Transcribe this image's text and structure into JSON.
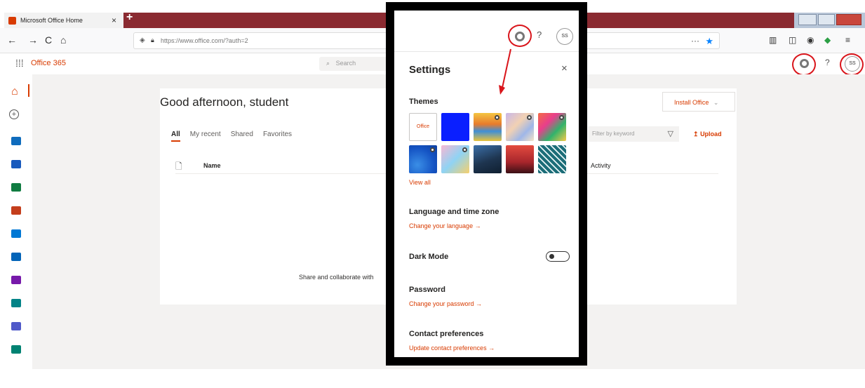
{
  "browser": {
    "tab_title": "Microsoft Office Home",
    "tab_close": "×",
    "new_tab": "+",
    "url": "https://www.office.com/?auth=2",
    "page_actions": "···",
    "nav_back": "←",
    "nav_forward": "→",
    "nav_reload": "C",
    "nav_home": "⌂",
    "menu": "≡"
  },
  "office": {
    "brand": "Office 365",
    "search_placeholder": "Search",
    "help": "?",
    "avatar": "SS",
    "greeting": "Good afternoon, student",
    "install_label": "Install Office",
    "tabs": [
      "All",
      "My recent",
      "Shared",
      "Favorites"
    ],
    "filter_placeholder": "Filter by keyword",
    "upload_label": "Upload",
    "columns": {
      "name": "Name",
      "activity": "Activity"
    },
    "empty_message": "Share and collaborate with"
  },
  "rail": {
    "apps": [
      {
        "name": "outlook",
        "color": "#0f6cbd"
      },
      {
        "name": "word",
        "color": "#185abd"
      },
      {
        "name": "excel",
        "color": "#107c41"
      },
      {
        "name": "powerpoint",
        "color": "#c43e1c"
      },
      {
        "name": "outlook-mail",
        "color": "#0078d4"
      },
      {
        "name": "onedrive",
        "color": "#0364b8"
      },
      {
        "name": "onenote",
        "color": "#7719aa"
      },
      {
        "name": "sharepoint",
        "color": "#038387"
      },
      {
        "name": "teams",
        "color": "#5059c9"
      },
      {
        "name": "sway",
        "color": "#008272"
      }
    ]
  },
  "settings": {
    "title": "Settings",
    "close": "×",
    "help": "?",
    "avatar": "SS",
    "themes_title": "Themes",
    "office_theme_label": "Office",
    "view_all": "View all",
    "language_title": "Language and time zone",
    "language_link": "Change your language →",
    "dark_mode_title": "Dark Mode",
    "dark_mode_on": false,
    "password_title": "Password",
    "password_link": "Change your password →",
    "contact_title": "Contact preferences",
    "contact_link": "Update contact preferences →"
  },
  "colors": {
    "accent": "#d83b01",
    "annotation": "#d9151b",
    "overlay_border": "#000000"
  }
}
